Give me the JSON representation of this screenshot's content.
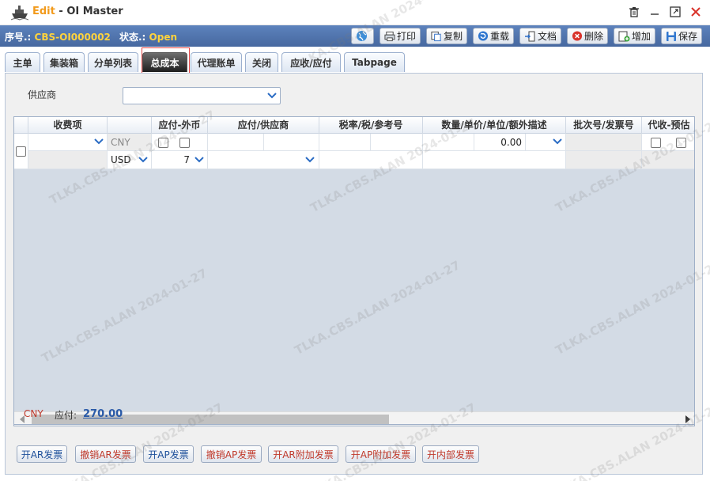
{
  "window": {
    "mode": "Edit",
    "separator": "-",
    "title": "OI Master"
  },
  "info": {
    "seq_label": "序号.:",
    "seq_value": "CBS-OI000002",
    "state_label": "状态.:",
    "state_value": "Open"
  },
  "toolbar": {
    "print": "打印",
    "copy": "复制",
    "reload": "重载",
    "docs": "文档",
    "delete": "删除",
    "add": "增加",
    "save": "保存"
  },
  "tabs": [
    "主单",
    "集装箱",
    "分单列表",
    "总成本",
    "代理账单",
    "关闭",
    "应收/应付",
    "Tabpage"
  ],
  "active_tab": "总成本",
  "supplier": {
    "label": "供应商",
    "value": ""
  },
  "grid": {
    "headers": [
      "收费项",
      "应付-外币",
      "应付/供应商",
      "税率/税/参考号",
      "数量/单价/单位/额外描述",
      "批次号/发票号",
      "代收-预估"
    ],
    "row": {
      "currency1": "CNY",
      "currency2": "USD",
      "rate": "7",
      "amount": "0.00"
    }
  },
  "summary": {
    "currency": "CNY",
    "label": "应付:",
    "value": "270.00"
  },
  "buttons": {
    "ar_invoice": "开AR发票",
    "cancel_ar": "撤销AR发票",
    "ap_invoice": "开AP发票",
    "cancel_ap": "撤销AP发票",
    "ar_extra": "开AR附加发票",
    "ap_extra": "开AP附加发票",
    "internal": "开内部发票"
  },
  "watermark": "TLKA.CBS.ALAN 2024-01-27",
  "colors": {
    "accent": "#f29a1b",
    "infobar": "#4f74ad",
    "state": "#ffd33d",
    "danger": "#c0392b",
    "link": "#2a5aa8"
  }
}
